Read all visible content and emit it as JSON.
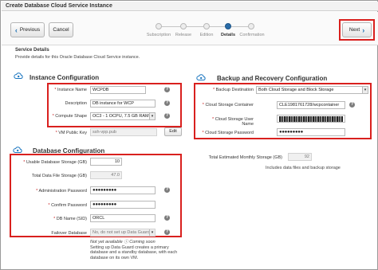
{
  "window": {
    "title": "Create Database Cloud Service Instance"
  },
  "toolbar": {
    "previous_label": "Previous",
    "cancel_label": "Cancel",
    "next_label": "Next"
  },
  "train": {
    "steps": [
      {
        "label": "Subscription"
      },
      {
        "label": "Release"
      },
      {
        "label": "Edition"
      },
      {
        "label": "Details",
        "current": true
      },
      {
        "label": "Confirmation"
      }
    ]
  },
  "page": {
    "header": "Service Details",
    "description": "Provide details for this Oracle Database Cloud Service instance."
  },
  "instance": {
    "title": "Instance Configuration",
    "name_label": "Instance Name",
    "name_value": "WCPDB",
    "description_label": "Description",
    "description_value": "DB instance for WCP",
    "shape_label": "Compute Shape",
    "shape_value": "OC3 - 1 OCPU, 7.5 GB RAM",
    "ssh_label": "VM Public Key",
    "ssh_value": "ssh-vpp.pub",
    "edit_label": "Edit"
  },
  "backup": {
    "title": "Backup and Recovery Configuration",
    "destination_label": "Backup Destination",
    "destination_value": "Both Cloud Storage and Block Storage",
    "container_label": "Cloud Storage Container",
    "container_value": "CLE1981761728/wcpcontainer",
    "user_label": "Cloud Storage User Name",
    "password_label": "Cloud Storage Password",
    "password_value": "●●●●●●●●●"
  },
  "storage": {
    "total_label": "Total Estimated Monthly Storage (GB)",
    "total_value": "92",
    "total_note": "Includes data files and backup storage"
  },
  "database": {
    "title": "Database Configuration",
    "usable_label": "Usable Database Storage (GB)",
    "usable_value": "10",
    "total_file_label": "Total Data File Storage (GB)",
    "total_file_value": "47.0",
    "admin_pw_label": "Administration Password",
    "admin_pw_value": "●●●●●●●●●",
    "confirm_pw_label": "Confirm Password",
    "confirm_pw_value": "●●●●●●●●●",
    "sid_label": "DB Name (SID)",
    "sid_value": "ORCL",
    "failover_label": "Failover Database",
    "failover_value": "No, do not set up Data Guard",
    "note_line1": "Not yet available ⓘ Coming soon",
    "note_line2": "Setting up Data Guard creates a primary",
    "note_line3": "database and a standby database, with each",
    "note_line4": "database on its own VM."
  },
  "icons": {
    "previous": "chevron-left-icon",
    "next": "chevron-right-icon",
    "section": "cloud-icon",
    "help": "help-icon"
  },
  "colors": {
    "accent": "#2a6ca8",
    "highlight": "#d9201e",
    "required": "#c81d1d"
  }
}
